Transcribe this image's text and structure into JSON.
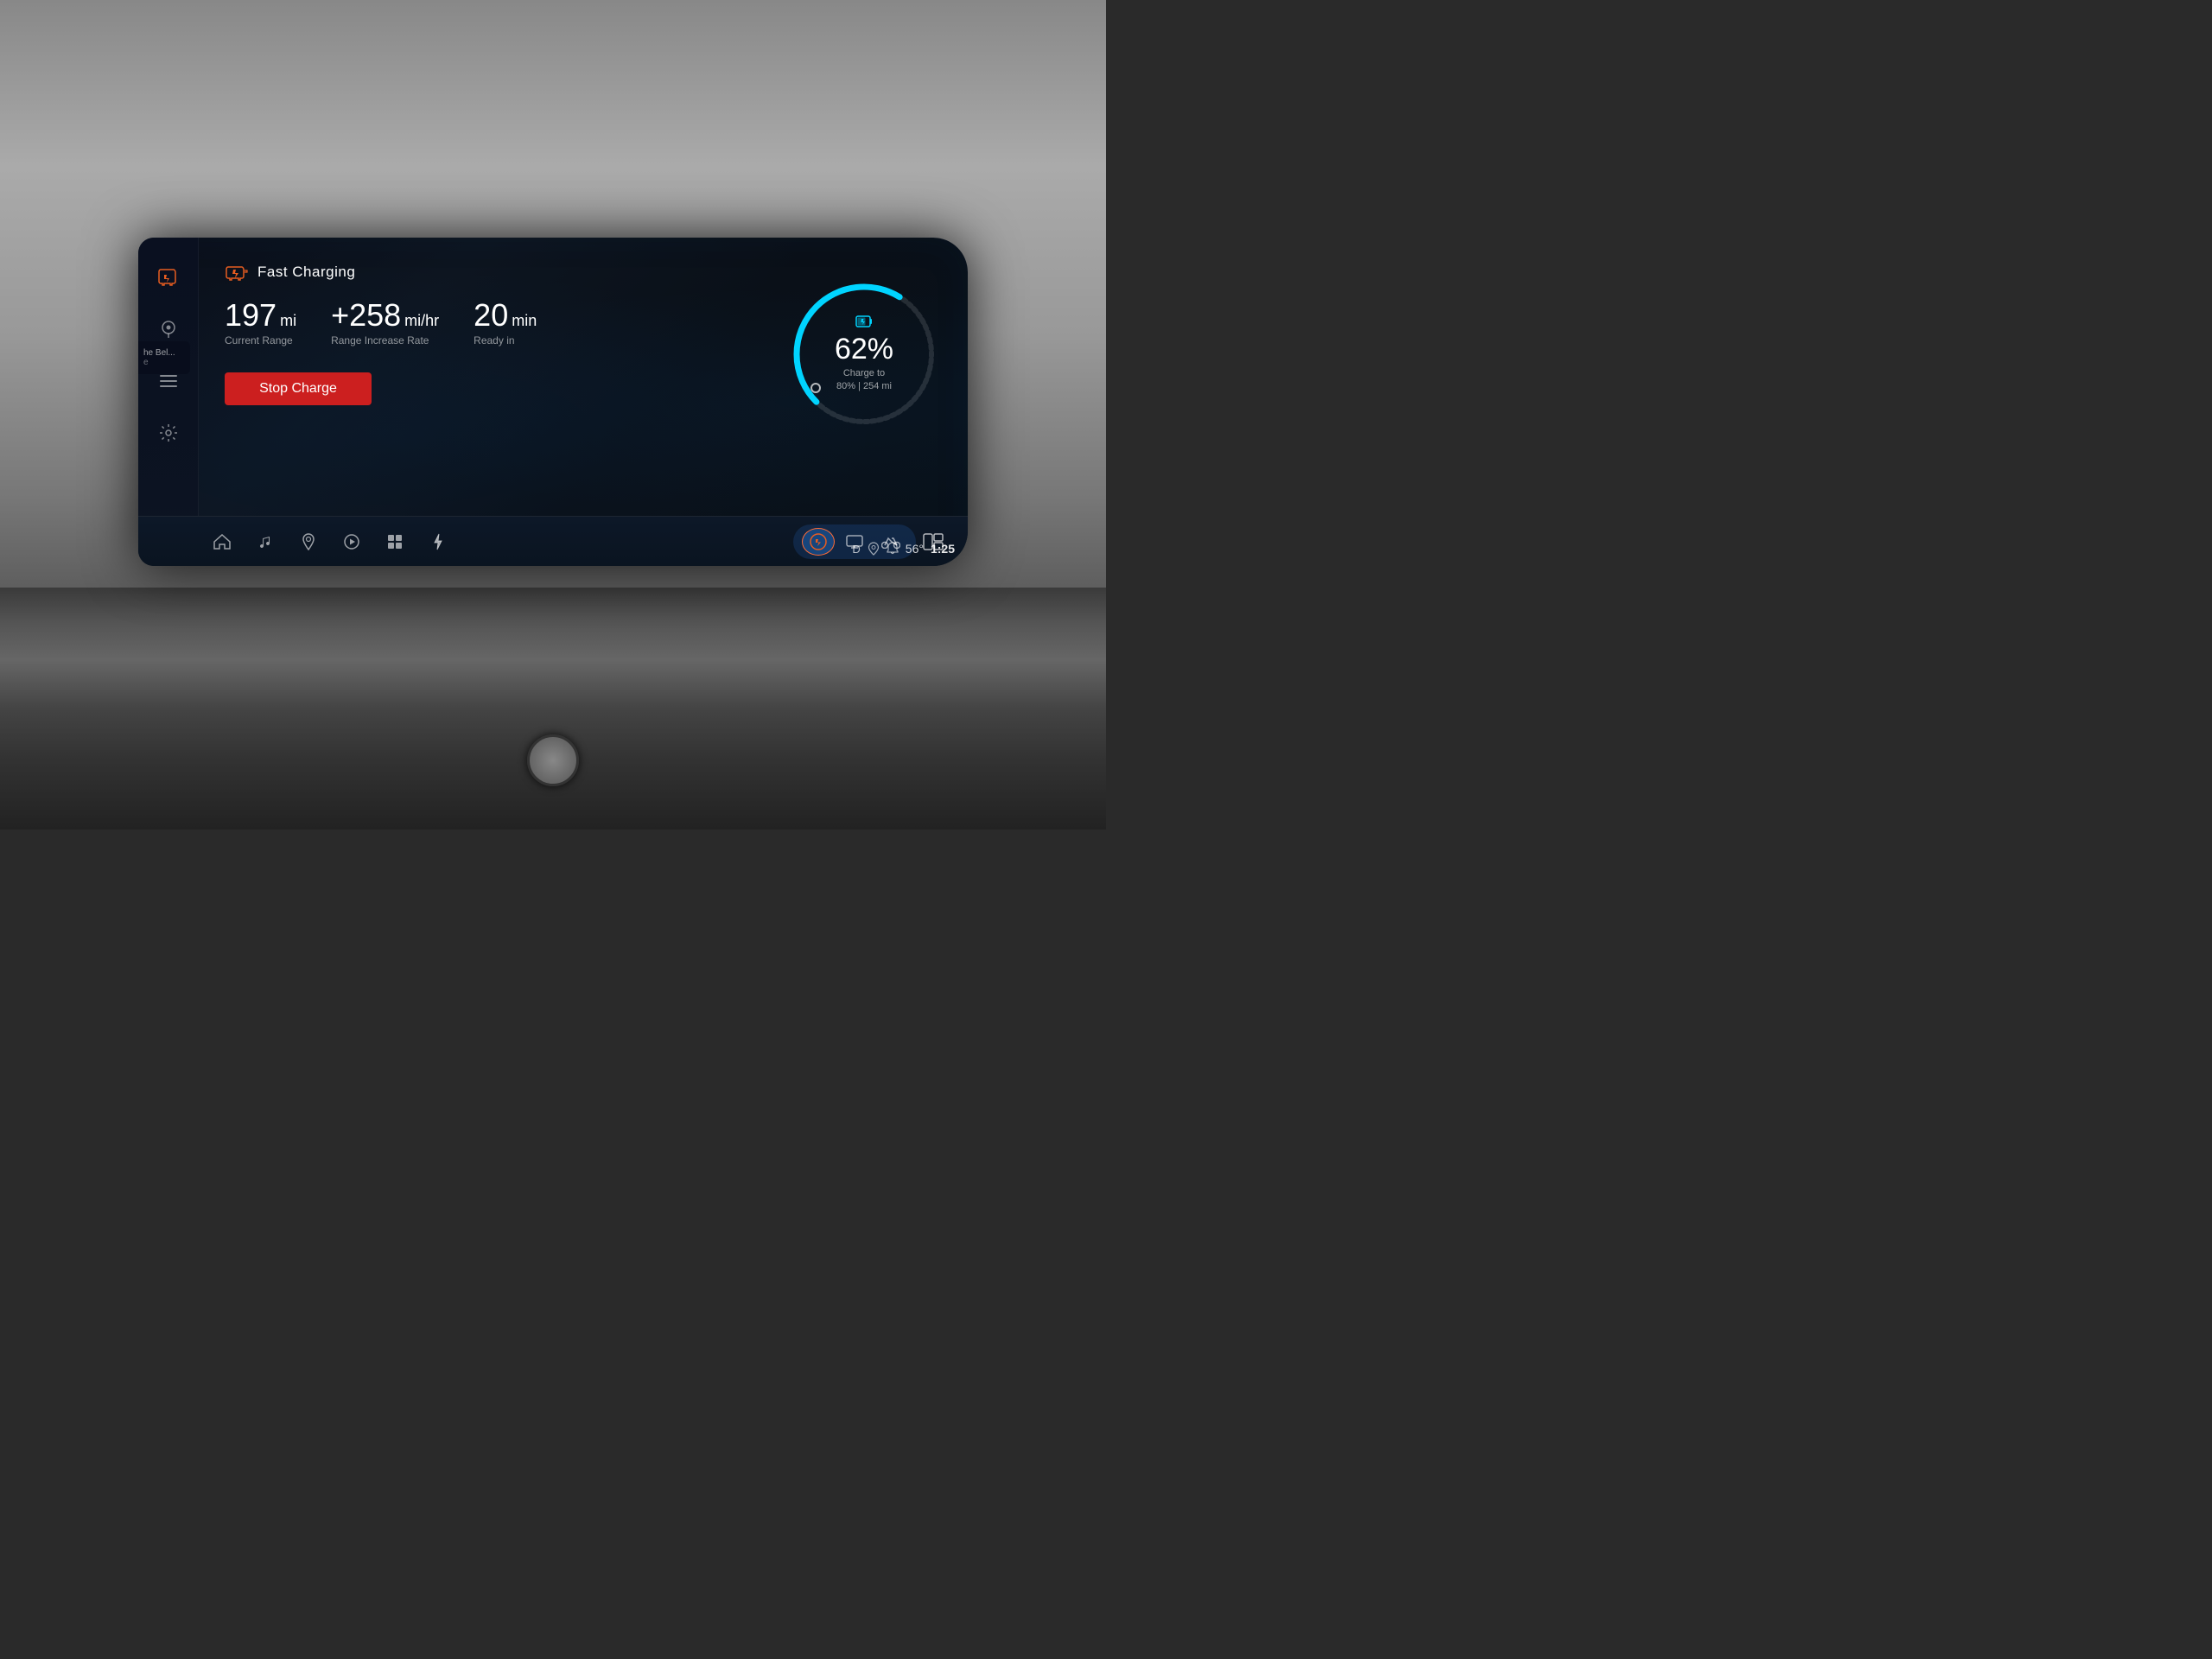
{
  "screen": {
    "title": "Fast Charging",
    "sidebar": {
      "icons": [
        {
          "name": "car-charging-icon",
          "symbol": "⚡",
          "active": true
        },
        {
          "name": "location-icon",
          "symbol": "📍",
          "active": false
        },
        {
          "name": "menu-icon",
          "symbol": "☰",
          "active": false
        },
        {
          "name": "settings-icon",
          "symbol": "⚙",
          "active": false
        }
      ]
    },
    "stats": [
      {
        "value": "197",
        "unit": "mi",
        "label": "Current Range"
      },
      {
        "value": "+258",
        "unit": "mi/hr",
        "label": "Range Increase Rate"
      },
      {
        "value": "20",
        "unit": "min",
        "label": "Ready in"
      }
    ],
    "stop_charge_button": "Stop Charge",
    "gauge": {
      "percent": "62%",
      "charge_to_label": "Charge to",
      "charge_to_value": "80% | 254 mi",
      "fill_percent": 62,
      "color": "#00d4ff",
      "track_color": "rgba(255,255,255,0.15)"
    },
    "bottom_nav": {
      "left_icons": [
        {
          "name": "home-nav-icon",
          "symbol": "⌂"
        },
        {
          "name": "music-nav-icon",
          "symbol": "♪"
        },
        {
          "name": "map-nav-icon",
          "symbol": "◎"
        },
        {
          "name": "play-nav-icon",
          "symbol": "▶"
        },
        {
          "name": "apps-nav-icon",
          "symbol": "⠿"
        },
        {
          "name": "charge-nav-icon",
          "symbol": "⚡"
        }
      ],
      "center_icons": [
        {
          "name": "ev-active-nav-icon",
          "symbol": "⚡",
          "active": true
        },
        {
          "name": "screen-nav-icon",
          "symbol": "▭"
        },
        {
          "name": "bike-nav-icon",
          "symbol": "◎"
        }
      ],
      "right_icons": [
        {
          "name": "split-screen-nav-icon",
          "symbol": "⊞"
        }
      ]
    },
    "status_bar": {
      "d_label": "D",
      "location_icon": "◎",
      "bell_icon": "🔔",
      "temperature": "56°",
      "time": "1:25"
    },
    "left_panel": {
      "label1": "he Bel...",
      "label2": "e"
    }
  }
}
